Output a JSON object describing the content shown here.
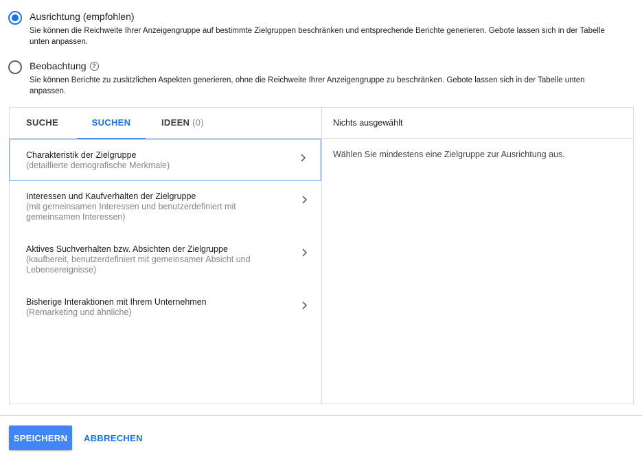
{
  "targeting": {
    "option1": {
      "label": "Ausrichtung (empfohlen)",
      "description": "Sie können die Reichweite Ihrer Anzeigengruppe auf bestimmte Zielgruppen beschränken und entsprechende Berichte generieren. Gebote lassen sich in der Tabelle unten anpassen.",
      "checked": true
    },
    "option2": {
      "label": "Beobachtung",
      "help_icon": "?",
      "description": "Sie können Berichte zu zusätzlichen Aspekten generieren, ohne die Reichweite Ihrer Anzeigengruppe zu beschränken. Gebote lassen sich in der Tabelle unten anpassen.",
      "checked": false
    }
  },
  "tabs": [
    {
      "label": "SUCHE"
    },
    {
      "label": "SUCHEN",
      "active": true
    },
    {
      "label": "IDEEN",
      "count": "(0)"
    }
  ],
  "categories": [
    {
      "title": "Charakteristik der Zielgruppe",
      "subtitle": "(detaillierte demografische Merkmale)"
    },
    {
      "title": "Interessen und Kaufverhalten der Zielgruppe",
      "subtitle": "(mit gemeinsamen Interessen und benutzerdefiniert mit gemeinsamen Interessen)"
    },
    {
      "title": "Aktives Suchverhalten bzw. Absichten der Zielgruppe",
      "subtitle": "(kaufbereit, benutzerdefiniert mit gemeinsamer Absicht und Lebensereignisse)"
    },
    {
      "title": "Bisherige Interaktionen mit Ihrem Unternehmen",
      "subtitle": "(Remarketing und ähnliche)"
    }
  ],
  "selection": {
    "header": "Nichts ausgewählt",
    "message": "Wählen Sie mindestens eine Zielgruppe zur Ausrichtung aus."
  },
  "actions": {
    "save_label": "SPEICHERN",
    "cancel_label": "ABBRECHEN"
  },
  "colors": {
    "accent": "#1a73e8",
    "primary_button": "#4285f4",
    "border": "#dadce0",
    "secondary_text": "#80868b"
  }
}
